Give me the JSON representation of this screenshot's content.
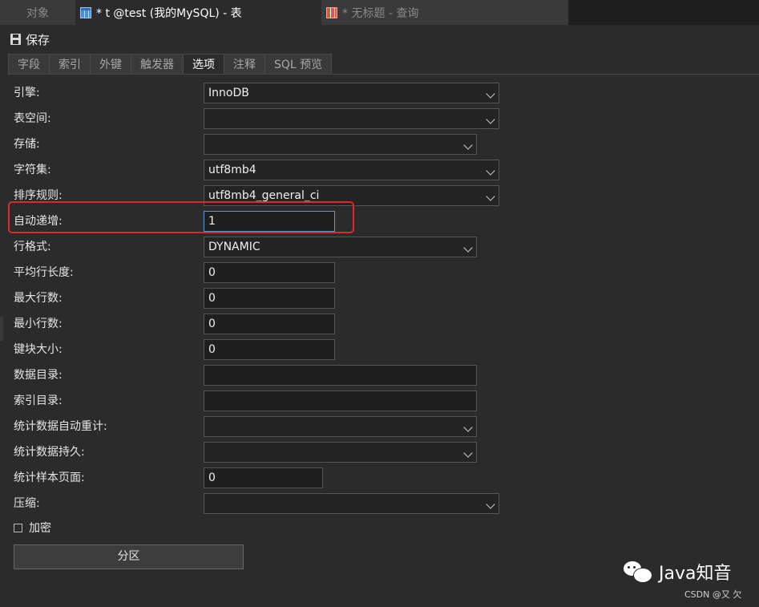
{
  "tabs": [
    {
      "label": "对象"
    },
    {
      "label": "* t @test (我的MySQL) - 表"
    },
    {
      "label": "* 无标题 - 查询"
    }
  ],
  "toolbar": {
    "save_label": "保存"
  },
  "subtabs": [
    "字段",
    "索引",
    "外键",
    "触发器",
    "选项",
    "注释",
    "SQL 预览"
  ],
  "form": {
    "engine": {
      "label": "引擎:",
      "value": "InnoDB"
    },
    "tablespace": {
      "label": "表空间:",
      "value": ""
    },
    "storage": {
      "label": "存储:",
      "value": ""
    },
    "charset": {
      "label": "字符集:",
      "value": "utf8mb4"
    },
    "collation": {
      "label": "排序规则:",
      "value": "utf8mb4_general_ci"
    },
    "auto_increment": {
      "label": "自动递增:",
      "value": "1"
    },
    "row_format": {
      "label": "行格式:",
      "value": "DYNAMIC"
    },
    "avg_row_length": {
      "label": "平均行长度:",
      "value": "0"
    },
    "max_rows": {
      "label": "最大行数:",
      "value": "0"
    },
    "min_rows": {
      "label": "最小行数:",
      "value": "0"
    },
    "key_block_size": {
      "label": "键块大小:",
      "value": "0"
    },
    "data_directory": {
      "label": "数据目录:",
      "value": ""
    },
    "index_directory": {
      "label": "索引目录:",
      "value": ""
    },
    "stats_auto_recalc": {
      "label": "统计数据自动重计:",
      "value": ""
    },
    "stats_persistent": {
      "label": "统计数据持久:",
      "value": ""
    },
    "stats_sample_pages": {
      "label": "统计样本页面:",
      "value": "0"
    },
    "compression": {
      "label": "压缩:",
      "value": ""
    },
    "encryption": {
      "label": "加密"
    },
    "partition_button": "分区"
  },
  "watermark": {
    "brand": "Java知音",
    "credit": "CSDN @又 欠"
  },
  "colors": {
    "background": "#2b2b2b",
    "highlight": "#e0272a",
    "focus": "#5b9bd5"
  }
}
